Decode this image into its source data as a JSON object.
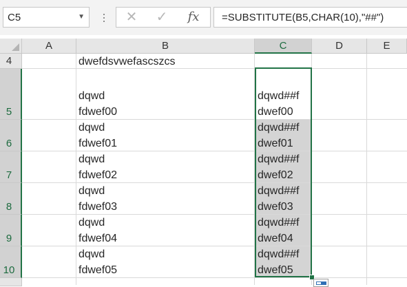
{
  "name_box": {
    "value": "C5",
    "dropdown_icon": "chevron-down-icon"
  },
  "formula_bar": {
    "cancel_icon": "close-icon",
    "enter_icon": "check-icon",
    "function_label": "fx",
    "formula": "=SUBSTITUTE(B5,CHAR(10),\"##\")"
  },
  "columns": [
    "A",
    "B",
    "C",
    "D",
    "E"
  ],
  "selected_column": "C",
  "rows": [
    "4",
    "5",
    "6",
    "7",
    "8",
    "9",
    "10"
  ],
  "selected_rows": [
    "5",
    "6",
    "7",
    "8",
    "9",
    "10"
  ],
  "cells": {
    "B4": "dwefdsvwefascszcs",
    "B5": [
      "dqwd",
      "fdwef00"
    ],
    "B6": [
      "dqwd",
      "fdwef01"
    ],
    "B7": [
      "dqwd",
      "fdwef02"
    ],
    "B8": [
      "dqwd",
      "fdwef03"
    ],
    "B9": [
      "dqwd",
      "fdwef04"
    ],
    "B10": [
      "dqwd",
      "fdwef05"
    ],
    "C5": [
      "dqwd##f",
      "dwef00"
    ],
    "C6": [
      "dqwd##f",
      "dwef01"
    ],
    "C7": [
      "dqwd##f",
      "dwef02"
    ],
    "C8": [
      "dqwd##f",
      "dwef03"
    ],
    "C9": [
      "dqwd##f",
      "dwef04"
    ],
    "C10": [
      "dqwd##f",
      "dwef05"
    ]
  },
  "colors": {
    "selection_border": "#217346",
    "selection_fill": "#d4d4d4",
    "header_bg": "#e6e6e6"
  }
}
